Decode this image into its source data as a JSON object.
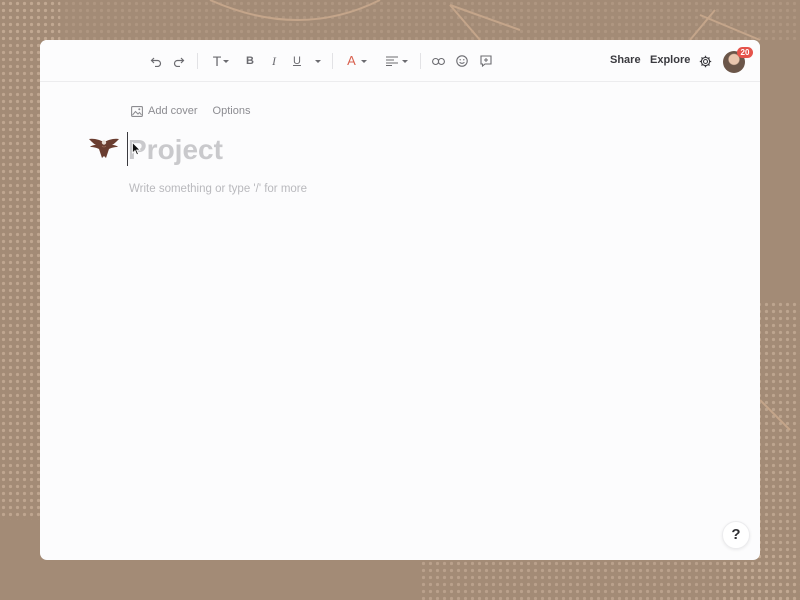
{
  "colors": {
    "background": "#a38b76",
    "window": "#fcfcfd",
    "text_color_accent": "#d9614f",
    "badge": "#e5534b"
  },
  "toolbar": {
    "undo_icon": "undo-icon",
    "redo_icon": "redo-icon",
    "text_style_glyph": "T",
    "bold_glyph": "B",
    "italic_glyph": "I",
    "underline_glyph": "U",
    "text_color_glyph": "A",
    "align_icon": "align-left-icon",
    "link_icon": "link-icon",
    "emoji_icon": "emoji-icon",
    "comment_icon": "add-comment-icon",
    "share_label": "Share",
    "explore_label": "Explore",
    "settings_icon": "gear-icon",
    "notification_count": "20"
  },
  "page": {
    "add_cover_label": "Add cover",
    "options_label": "Options",
    "page_icon": "eagle-icon",
    "title_placeholder": "Project",
    "body_placeholder": "Write something or type '/' for more"
  },
  "help": {
    "label": "?"
  }
}
